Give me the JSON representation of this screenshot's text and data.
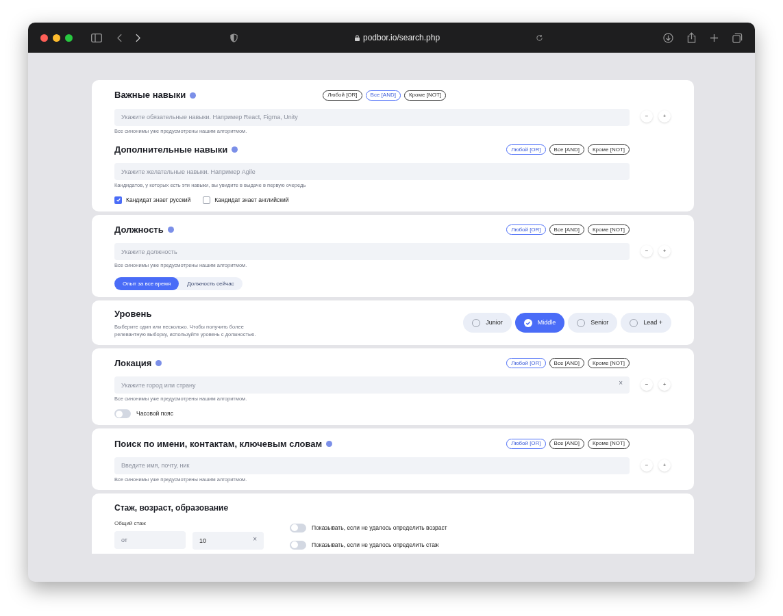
{
  "browser": {
    "url": "podbor.io/search.php"
  },
  "cards": [
    {
      "kind": "form",
      "groups": [
        {
          "title": "Важные навыки",
          "modes": [
            {
              "label": "Любой [OR]",
              "selected": false
            },
            {
              "label": "Все [AND]",
              "selected": true
            },
            {
              "label": "Кроме [NOT]",
              "selected": false
            }
          ],
          "placeholder": "Укажите обязательные навыки. Например React, Figma, Unity",
          "hint": "Все синонимы уже предусмотрены нашим алгоритмом.",
          "stepper": [
            "−",
            "+"
          ]
        },
        {
          "title": "Дополнительные навыки",
          "modes": [
            {
              "label": "Любой [OR]",
              "selected": true
            },
            {
              "label": "Все [AND]",
              "selected": false
            },
            {
              "label": "Кроме [NOT]",
              "selected": false
            }
          ],
          "placeholder": "Укажите желательные навыки. Например Agile",
          "hint": "Кандидатов, у которых есть эти навыки, вы увидите в выдаче в первую очередь"
        }
      ],
      "checkboxes": [
        {
          "label": "Кандидат знает русский",
          "checked": true
        },
        {
          "label": "Кандидат знает английский",
          "checked": false
        }
      ]
    },
    {
      "kind": "form",
      "groups": [
        {
          "title": "Должность",
          "modes": [
            {
              "label": "Любой [OR]",
              "selected": true
            },
            {
              "label": "Все [AND]",
              "selected": false
            },
            {
              "label": "Кроме [NOT]",
              "selected": false
            }
          ],
          "placeholder": "Укажите должность",
          "hint": "Все синонимы уже предусмотрены нашим алгоритмом.",
          "stepper": [
            "−",
            "+"
          ]
        }
      ],
      "segments": [
        {
          "label": "Опыт за все время",
          "selected": true
        },
        {
          "label": "Должность сейчас",
          "selected": false
        }
      ]
    },
    {
      "kind": "level",
      "title": "Уровень",
      "description": "Выберите один или несколько. Чтобы получить более релевантную выборку, используйте уровень с должностью.",
      "options": [
        {
          "label": "Junior",
          "selected": false
        },
        {
          "label": "Middle",
          "selected": true
        },
        {
          "label": "Senior",
          "selected": false
        },
        {
          "label": "Lead +",
          "selected": false
        }
      ]
    },
    {
      "kind": "form",
      "groups": [
        {
          "title": "Локация",
          "modes": [
            {
              "label": "Любой [OR]",
              "selected": true
            },
            {
              "label": "Все [AND]",
              "selected": false
            },
            {
              "label": "Кроме [NOT]",
              "selected": false
            }
          ],
          "placeholder": "Укажите город или страну",
          "clear": "×",
          "hint": "Все синонимы уже предусмотрены нашим алгоритмом.",
          "stepper": [
            "−",
            "+"
          ]
        }
      ],
      "toggles": [
        {
          "label": "Часовой пояс",
          "on": false
        }
      ]
    },
    {
      "kind": "form",
      "groups": [
        {
          "title": "Поиск по имени, контактам, ключевым словам",
          "modes": [
            {
              "label": "Любой [OR]",
              "selected": true
            },
            {
              "label": "Все [AND]",
              "selected": false
            },
            {
              "label": "Кроме [NOT]",
              "selected": false
            }
          ],
          "placeholder": "Введите имя, почту, ник",
          "hint": "Все синонимы уже предусмотрены нашим алгоритмом.",
          "stepper": [
            "−",
            "+"
          ]
        }
      ]
    },
    {
      "kind": "experience",
      "title": "Стаж, возраст, образование",
      "field_label": "Общий стаж",
      "from_placeholder": "от",
      "to_value": "10",
      "clear": "×",
      "toggles": [
        {
          "label": "Показывать, если не удалось определить возраст",
          "on": false
        },
        {
          "label": "Показывать, если не удалось определить стаж",
          "on": false
        }
      ]
    }
  ]
}
